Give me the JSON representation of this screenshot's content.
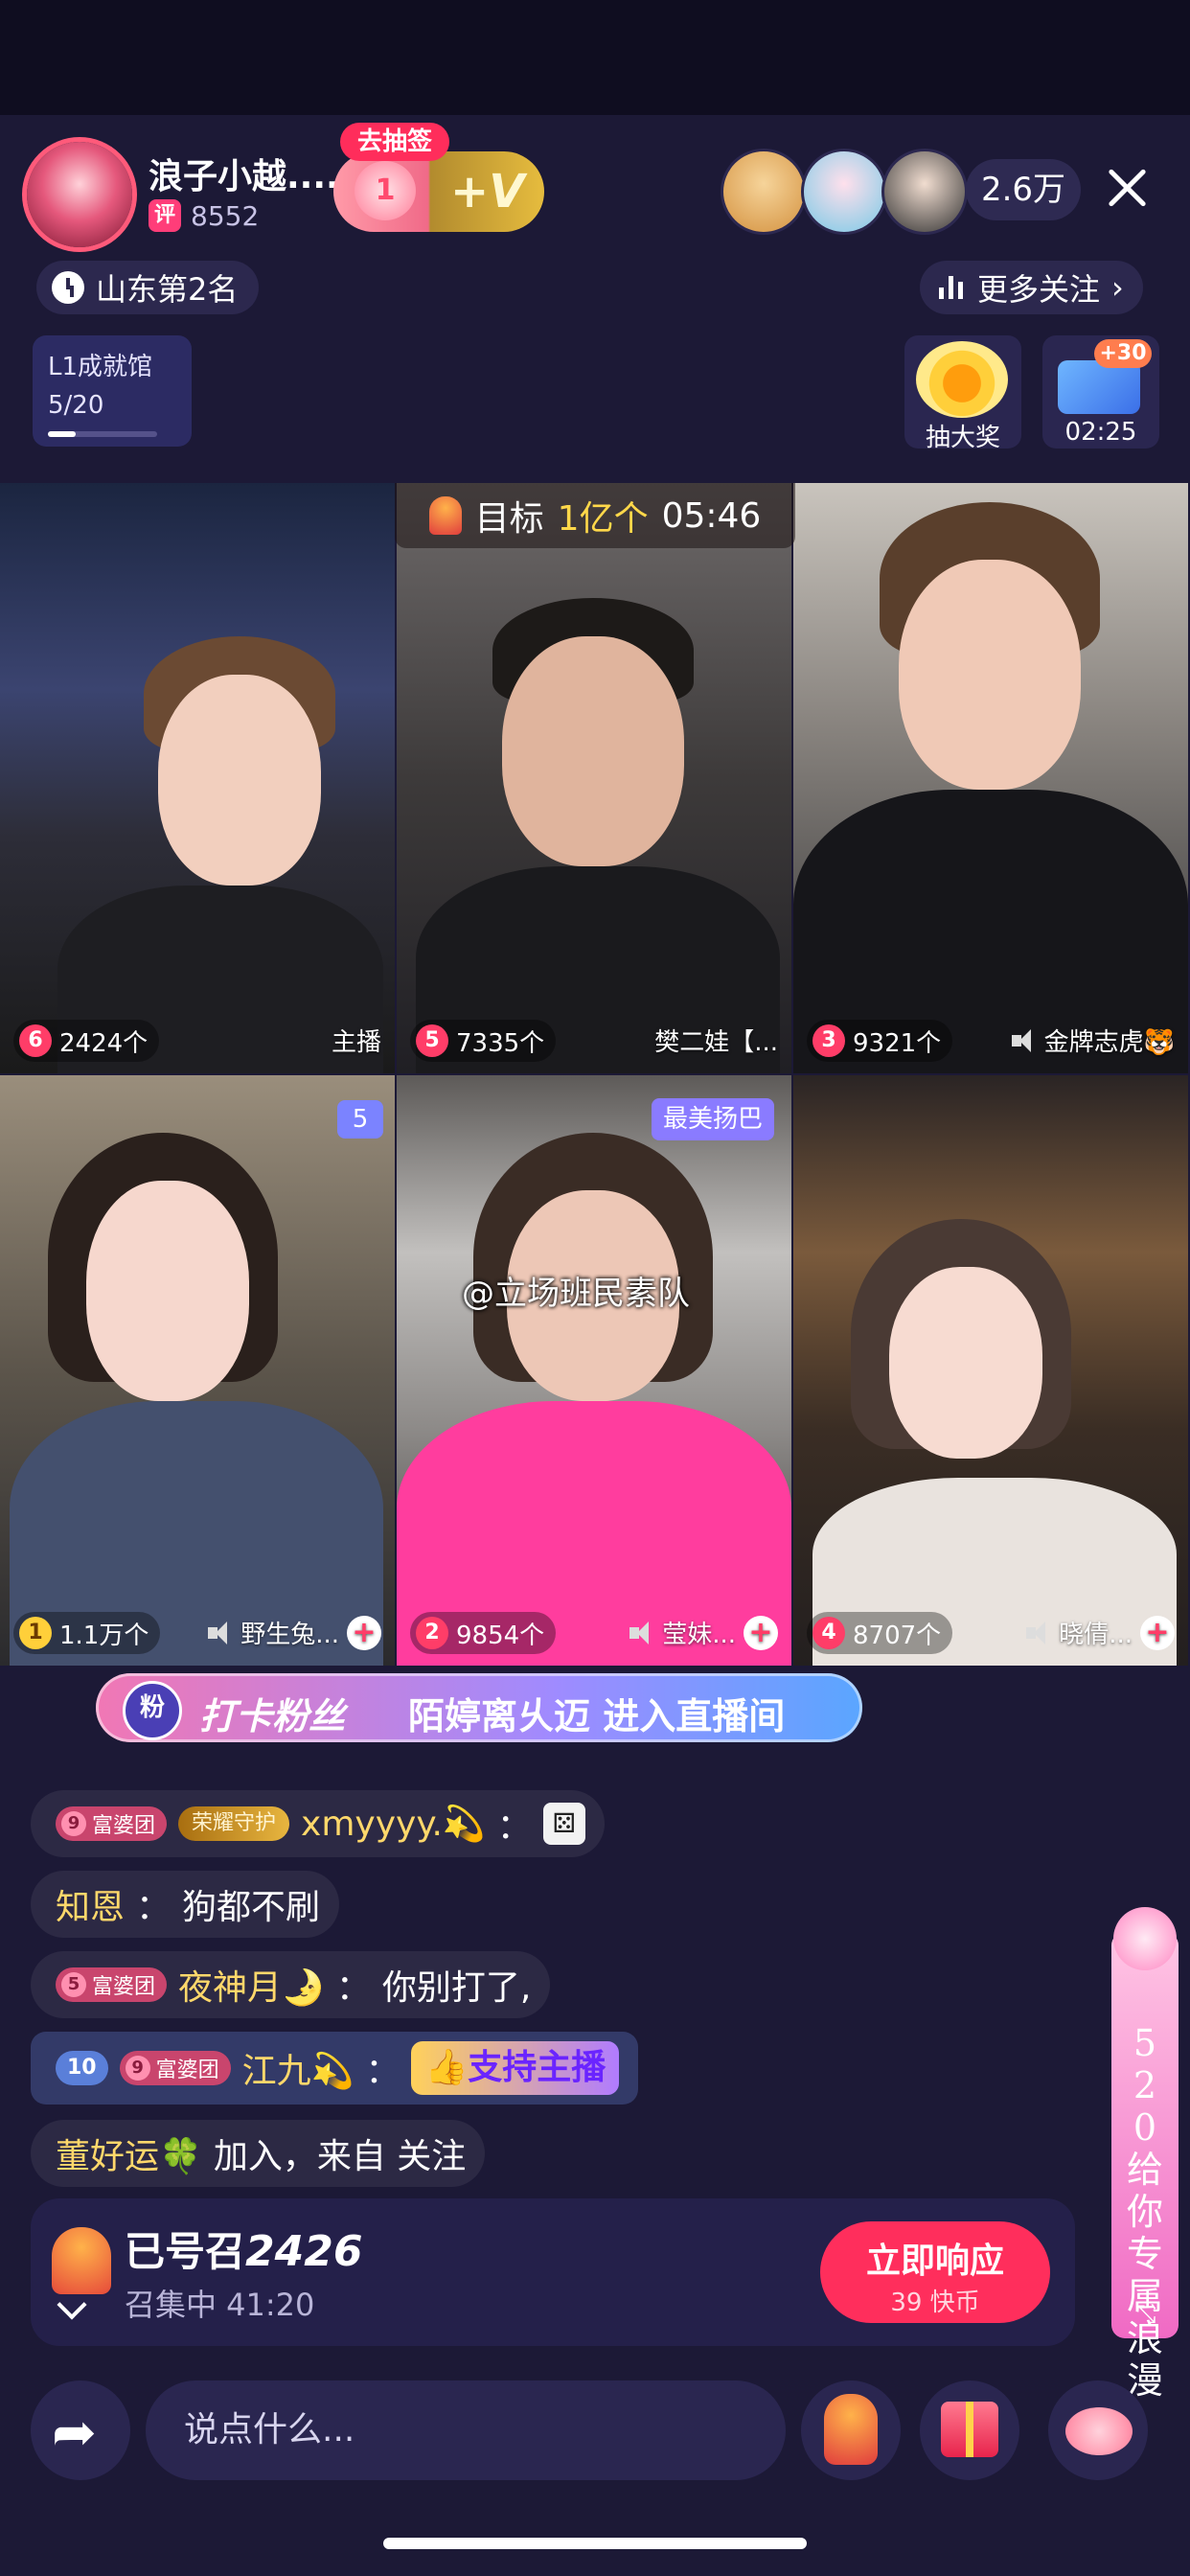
{
  "header": {
    "host_name": "浪子小越....",
    "rating": "8552",
    "rating_icon": "评",
    "draw_tag": "去抽签",
    "heart_count": "1",
    "plus_v": "+V",
    "viewer_count": "2.6万",
    "rank": "山东第2名",
    "more_follow": "更多关注",
    "level_title": "L1成就馆",
    "level_progress": "5/20",
    "level_progress_fraction": 0.25,
    "prize_label": "抽大奖",
    "timer_plus": "+30",
    "timer_label": "02:25"
  },
  "pk_goal": {
    "label": "目标",
    "amount": "1亿个",
    "time": "05:46"
  },
  "tiles": [
    {
      "rank": "6",
      "count": "2424个",
      "name": "主播",
      "muted": false
    },
    {
      "rank": "5",
      "count": "7335个",
      "name": "樊二娃【...",
      "muted": false
    },
    {
      "rank": "3",
      "count": "9321个",
      "name": "金牌志虎🐯",
      "muted": true
    },
    {
      "rank": "1",
      "count": "1.1万个",
      "name": "野生兔...",
      "muted": true
    },
    {
      "rank": "2",
      "count": "9854个",
      "name": "莹妹...",
      "muted": true
    },
    {
      "rank": "4",
      "count": "8707个",
      "name": "晓倩...",
      "muted": true
    }
  ],
  "tile_tags": {
    "tile4_tag": "5",
    "tile5_tag": "最美扬巴"
  },
  "watermark": "@立场班民素队",
  "fans_banner": {
    "icon": "粉",
    "title": "打卡粉丝",
    "text": "陌婷离乆迈 进入直播间"
  },
  "comments": [
    {
      "badges": [
        "9 富婆团",
        "荣耀守护"
      ],
      "user": "xmyyyy.💫",
      "sep": "：",
      "message": ""
    },
    {
      "badges": [],
      "user": "知恩",
      "sep": "：",
      "message": "狗都不刷"
    },
    {
      "badges": [
        "5 富婆团"
      ],
      "user": "夜神月🌛",
      "sep": "：",
      "message": "你别打了,"
    },
    {
      "badges": [
        "10",
        "9 富婆团"
      ],
      "user": "江九💫",
      "sep": "：",
      "message": "👍支持主播"
    },
    {
      "badges": [],
      "user": "董好运🍀",
      "sep": "",
      "message": "加入，来自 关注"
    }
  ],
  "badge_labels": {
    "lv9": "9",
    "lv5": "5",
    "fupo": "富婆团",
    "glory": "荣耀守护",
    "lv10": "10"
  },
  "summon": {
    "prefix": "已号召",
    "count": "2426",
    "status": "召集中 41:20",
    "button": "立即响应",
    "cost": "39 快币"
  },
  "side_banner": {
    "text": "520给你专属浪漫"
  },
  "bottom": {
    "placeholder": "说点什么..."
  },
  "colors": {
    "background": "#1c1936",
    "accent_pink": "#ff2e5c",
    "username_gold": "#ffd86b"
  }
}
